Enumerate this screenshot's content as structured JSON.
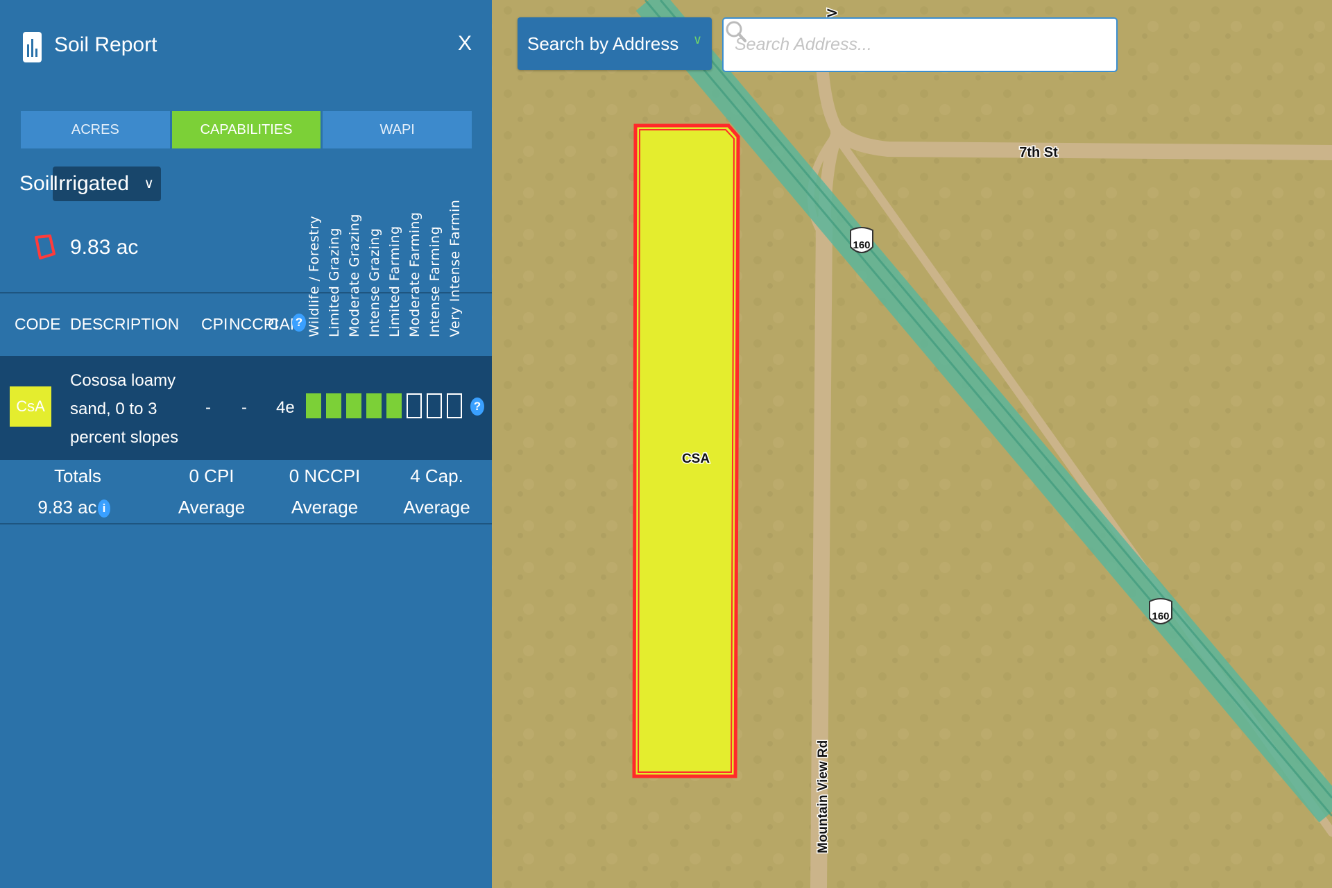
{
  "panel": {
    "title": "Soil Report",
    "close_label": "X",
    "tabs": [
      {
        "label": "ACRES",
        "active": false
      },
      {
        "label": "CAPABILITIES",
        "active": true
      },
      {
        "label": "WAPI",
        "active": false
      }
    ],
    "soil_label": "Soil:",
    "soil_value": "Irrigated",
    "acres": "9.83 ac",
    "columns": {
      "code": "CODE",
      "description": "DESCRIPTION",
      "cpi": "CPI",
      "nccpi": "NCCPI",
      "cap": "CAP"
    },
    "capability_headers": [
      "Wildlife / Forestry",
      "Limited Grazing",
      "Moderate Grazing",
      "Intense Grazing",
      "Limited Farming",
      "Moderate Farming",
      "Intense Farming",
      "Very Intense Farmin"
    ],
    "rows": [
      {
        "code": "CsA",
        "description": "Cososa loamy sand, 0 to 3 percent slopes",
        "cpi": "-",
        "nccpi": "-",
        "cap": "4e",
        "capability_level": 5,
        "capability_total": 8
      }
    ],
    "totals": {
      "label": "Totals",
      "acres": "9.83 ac",
      "cpi": "0 CPI",
      "cpi_sub": "Average",
      "nccpi": "0 NCCPI",
      "nccpi_sub": "Average",
      "cap": "4 Cap.",
      "cap_sub": "Average"
    }
  },
  "map": {
    "search_mode": "Search by Address",
    "search_placeholder": "Search Address...",
    "parcel_label": "CSA",
    "road_7th": "7th St",
    "road_mountain": "Mountain View Rd",
    "shield_1": "160",
    "shield_2": "160",
    "top_label": "V"
  },
  "colors": {
    "panel_bg": "#2b72a9",
    "tab_active": "#7cd037",
    "tab_inactive": "#3d8acc",
    "row_bg": "#174770",
    "parcel_fill": "#e4ed2e",
    "parcel_stroke": "#ff2a2a",
    "highway": "#5db59a"
  }
}
